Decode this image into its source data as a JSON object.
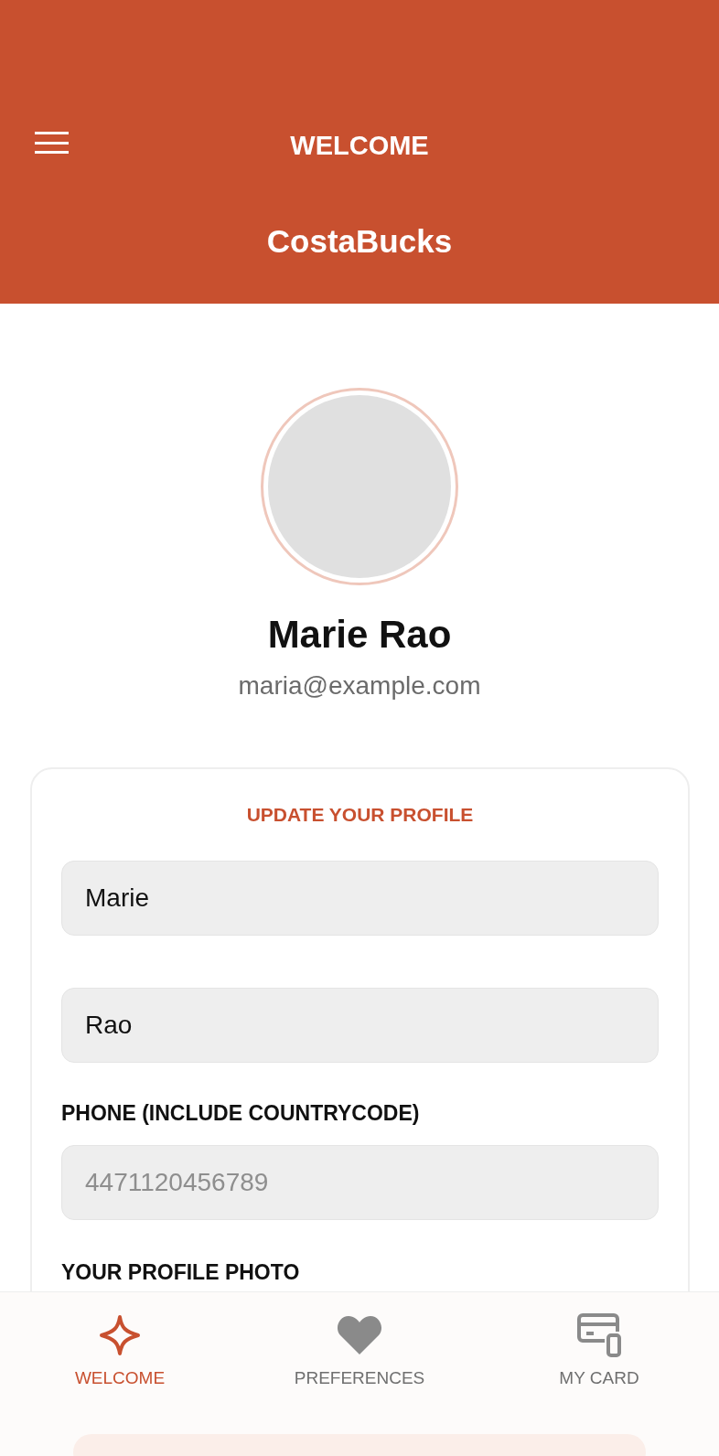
{
  "header": {
    "title": "WELCOME",
    "brand": "CostaBucks"
  },
  "profile": {
    "name": "Marie Rao",
    "email": "maria@example.com"
  },
  "form": {
    "title": "UPDATE YOUR PROFILE",
    "fields": [
      {
        "value": "Marie"
      },
      {
        "value": "Rao"
      },
      {
        "label": "PHONE (INCLUDE COUNTRYCODE)",
        "placeholder": "4471120456789"
      }
    ],
    "photo_label": "YOUR PROFILE PHOTO"
  },
  "bottom_nav": [
    {
      "label": "WELCOME",
      "kind": "star",
      "selected": true
    },
    {
      "label": "PREFERENCES",
      "kind": "heart",
      "selected": false
    },
    {
      "label": "MY CARD",
      "kind": "card",
      "selected": false
    }
  ]
}
